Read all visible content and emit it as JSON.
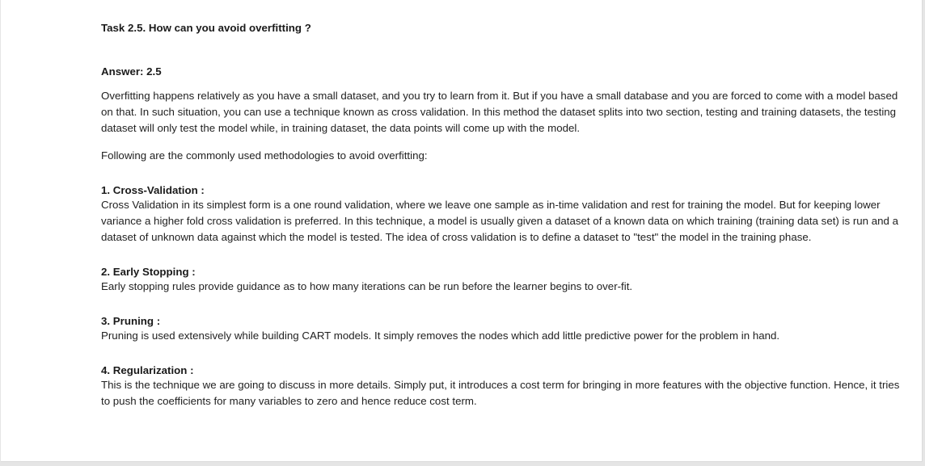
{
  "task_title": "Task 2.5. How can you avoid overfitting ?",
  "answer_label": "Answer: 2.5",
  "paragraphs": [
    "Overfitting happens relatively as you have a small dataset, and you try to learn from it. But if you have a small database and you are forced to come with a model based on that. In such situation, you can use a technique known as cross validation. In this method the dataset splits into two section, testing and training datasets, the testing dataset will only test the model while, in training dataset, the data points will come up with the model.",
    "Following are the commonly used methodologies to avoid overfitting:"
  ],
  "sections": [
    {
      "heading": "1. Cross-Validation :",
      "body": "Cross Validation in its simplest form is a one round validation, where we leave one sample as in-time validation and rest for training the model. But for keeping lower variance a higher fold cross validation is preferred. In this technique, a model is usually given a dataset of a known data on which training (training data set) is run and a dataset of unknown data against which the model is tested. The idea of cross validation is to define a dataset to \"test\" the model in the training phase."
    },
    {
      "heading": "2. Early Stopping :",
      "body": "Early stopping rules provide guidance as to how many iterations can be run before the learner begins to over-fit."
    },
    {
      "heading": "3. Pruning :",
      "body": "Pruning is used extensively while building CART models. It simply removes the nodes which add little predictive power for the problem in hand."
    },
    {
      "heading": "4. Regularization :",
      "body": "This is the technique we are going to discuss in more details. Simply put, it introduces a cost term for bringing in more features with the objective function. Hence, it tries to push the coefficients for many variables to zero and hence reduce cost term."
    }
  ]
}
